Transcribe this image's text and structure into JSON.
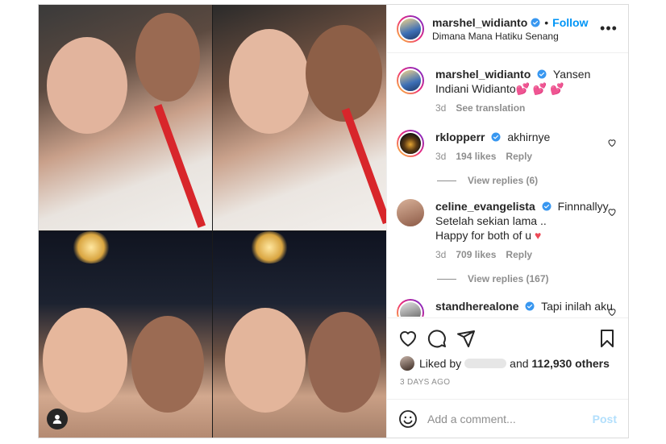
{
  "post": {
    "author": "marshel_widianto",
    "follow_label": "Follow",
    "dot": "•",
    "location": "Dimana Mana Hatiku Senang",
    "more": "•••"
  },
  "caption": {
    "username": "marshel_widianto",
    "text": "Yansen Indiani Widianto💕 💕 💕",
    "time": "3d",
    "translate": "See translation"
  },
  "comments": [
    {
      "username": "rklopperr",
      "text": "akhirnye",
      "time": "3d",
      "likes": "194 likes",
      "reply": "Reply",
      "view_replies": "View replies (6)"
    },
    {
      "username": "celine_evangelista",
      "text_line1": "Finnnallyy",
      "text_line2": "Setelah sekian lama ..",
      "text_line3": "Happy for both of u",
      "heart": "♥",
      "time": "3d",
      "likes": "709 likes",
      "reply": "Reply",
      "view_replies": "View replies (167)"
    },
    {
      "username": "standherealone",
      "text": "Tapi inilah aku . ."
    }
  ],
  "likes": {
    "prefix": "Liked by",
    "suffix": "and",
    "count": "112,930 others"
  },
  "date": "3 DAYS AGO",
  "composer": {
    "placeholder": "Add a comment...",
    "post_label": "Post"
  },
  "icons": [
    "heart-icon",
    "comment-icon",
    "share-icon",
    "bookmark-icon",
    "emoji-icon",
    "more-icon",
    "verified-icon",
    "user-tag-icon"
  ],
  "colors": {
    "link": "#0095f6",
    "verified": "#3897f0",
    "post_disabled": "#b2dffc",
    "heart_red": "#ed4956"
  }
}
